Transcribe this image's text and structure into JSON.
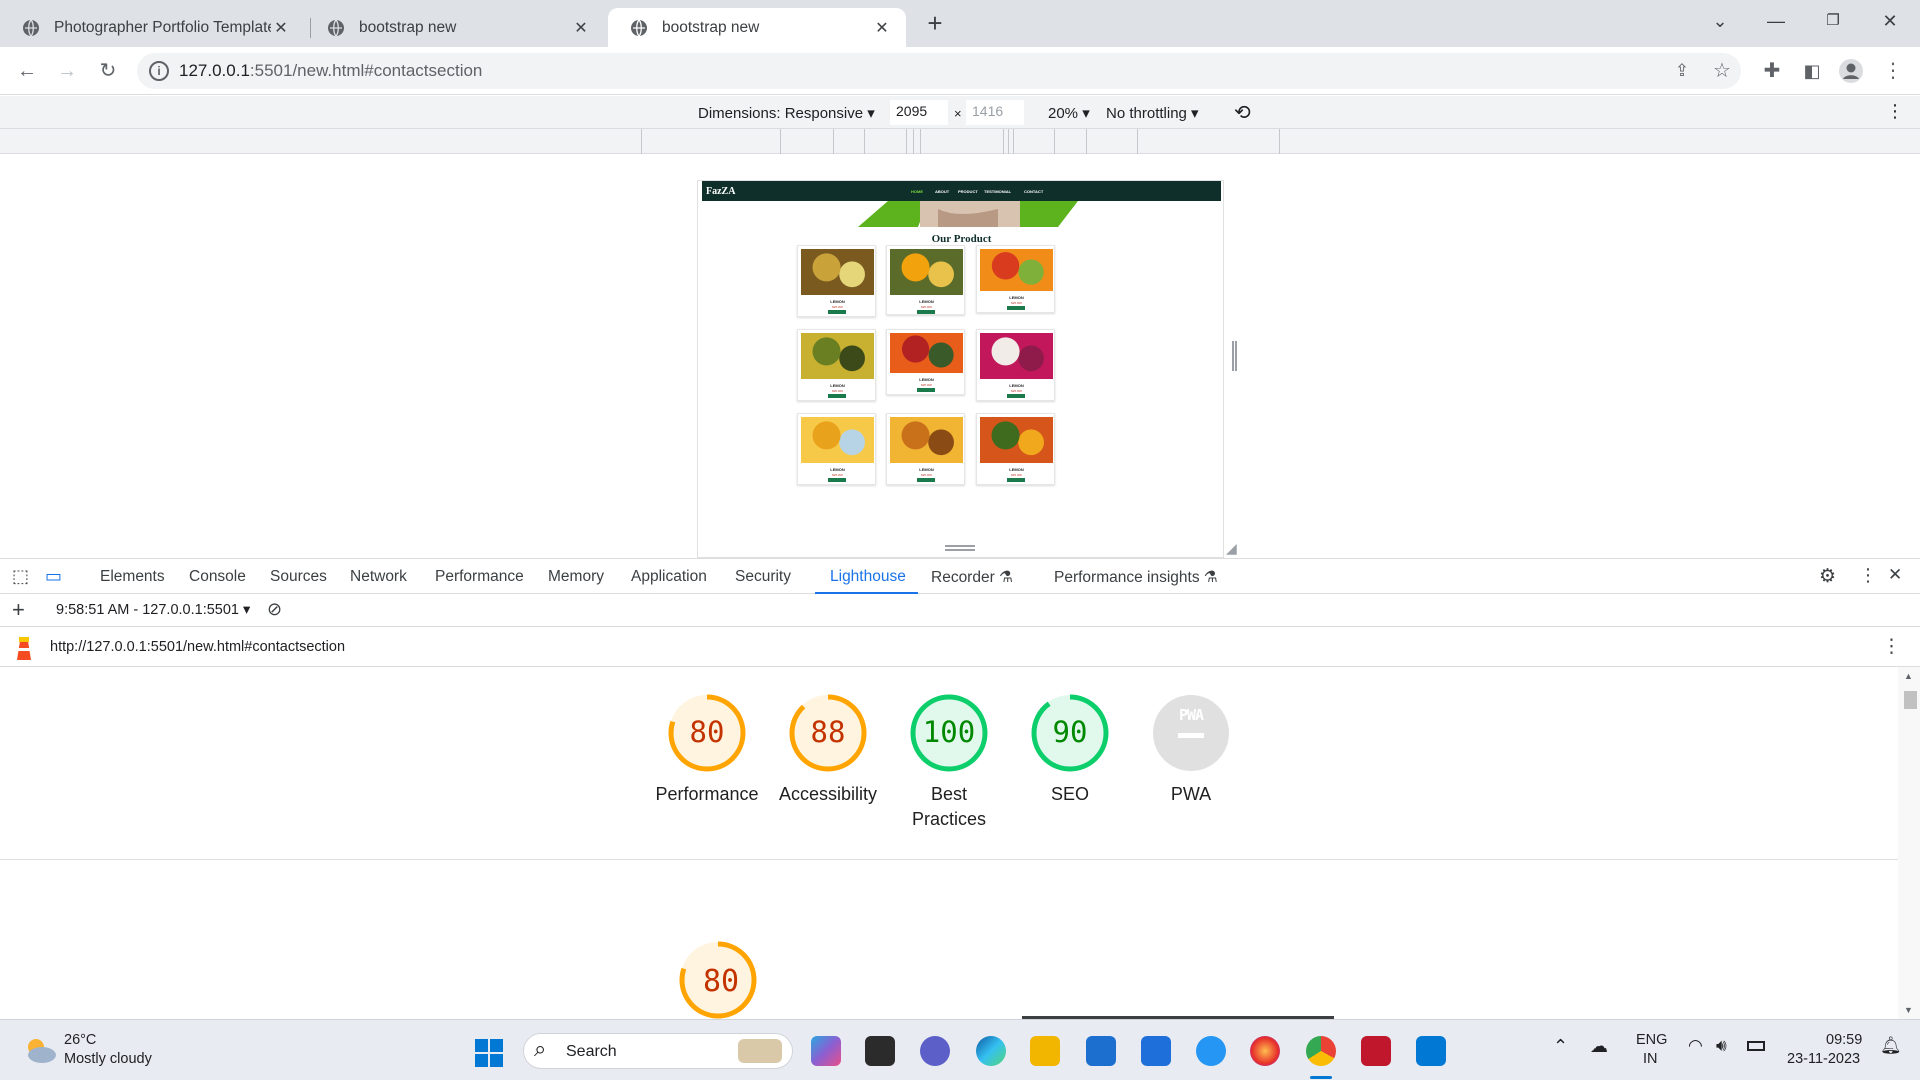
{
  "browser": {
    "tabs": [
      {
        "title": "Photographer Portfolio Template",
        "active": false
      },
      {
        "title": "bootstrap new",
        "active": false
      },
      {
        "title": "bootstrap new",
        "active": true
      }
    ],
    "new_tab_icon": "plus-icon",
    "url_host": "127.0.0.1",
    "url_rest": ":5501/new.html#contactsection"
  },
  "device_toolbar": {
    "dimensions_label": "Dimensions: Responsive",
    "width": "2095",
    "height": "1416",
    "times": "×",
    "zoom": "20%",
    "throttling": "No throttling"
  },
  "site": {
    "logo": "FazZA",
    "nav": [
      "HOME",
      "ABOUT",
      "PRODUCT",
      "TESTIMONIAL",
      "CONTACT"
    ],
    "section_title": "Our Product",
    "products": [
      {
        "name": "LEMON",
        "price": "$25.000",
        "button": "Buy now"
      },
      {
        "name": "LEMON",
        "price": "$25.000",
        "button": "Buy now"
      },
      {
        "name": "LEMON",
        "price": "$25.000",
        "button": "Buy now"
      },
      {
        "name": "LEMON",
        "price": "$25.000",
        "button": "Buy now"
      },
      {
        "name": "LEMON",
        "price": "$25.000",
        "button": "Buy now"
      },
      {
        "name": "LEMON",
        "price": "$25.000",
        "button": "Buy now"
      },
      {
        "name": "LEMON",
        "price": "$25.000",
        "button": "Buy now"
      },
      {
        "name": "LEMON",
        "price": "$25.000",
        "button": "Buy now"
      },
      {
        "name": "LEMON",
        "price": "$25.000",
        "button": "Buy now"
      }
    ]
  },
  "devtools": {
    "tabs": [
      "Elements",
      "Console",
      "Sources",
      "Network",
      "Performance",
      "Memory",
      "Application",
      "Security",
      "Lighthouse",
      "Recorder",
      "Performance insights"
    ],
    "active_tab": "Lighthouse",
    "report_selector": "9:58:51 AM - 127.0.0.1:5501",
    "report_url": "http://127.0.0.1:5501/new.html#contactsection",
    "scores": [
      {
        "label": "Performance",
        "value": "80",
        "score": 80,
        "color": "#ffa400",
        "text_color": "#c33300"
      },
      {
        "label": "Accessibility",
        "value": "88",
        "score": 88,
        "color": "#ffa400",
        "text_color": "#c33300"
      },
      {
        "label": "Best Practices",
        "value": "100",
        "score": 100,
        "color": "#0cce6b",
        "text_color": "#008800"
      },
      {
        "label": "SEO",
        "value": "90",
        "score": 90,
        "color": "#0cce6b",
        "text_color": "#008800"
      },
      {
        "label": "PWA",
        "value": "PWA",
        "score": null,
        "color": "#e0e0e0",
        "text_color": "#9e9e9e"
      }
    ],
    "big_score": {
      "value": "80",
      "score": 80
    }
  },
  "taskbar": {
    "weather_temp": "26°C",
    "weather_desc": "Mostly cloudy",
    "search_placeholder": "Search",
    "lang_top": "ENG",
    "lang_bottom": "IN",
    "time": "09:59",
    "date": "23-11-2023"
  },
  "colors": {
    "accent": "#1a73e8",
    "score_average": "#ffa400",
    "score_pass": "#0cce6b"
  }
}
